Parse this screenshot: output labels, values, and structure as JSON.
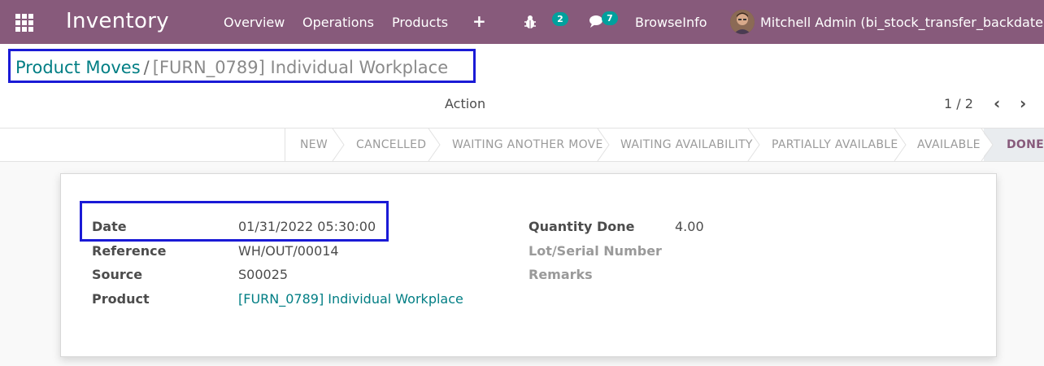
{
  "navbar": {
    "app_name": "Inventory",
    "menu": [
      "Overview",
      "Operations",
      "Products"
    ],
    "plus_icon": "+",
    "bug_badge": "2",
    "chat_badge": "7",
    "company": "BrowseInfo",
    "user": "Mitchell Admin (bi_stock_transfer_backdate)",
    "color": "#875a7b"
  },
  "breadcrumb": {
    "parent": "Product Moves",
    "separator": "/",
    "current": "[FURN_0789] Individual Workplace"
  },
  "control": {
    "action_label": "Action",
    "pager": "1 / 2"
  },
  "statusbar": {
    "steps": [
      "NEW",
      "CANCELLED",
      "WAITING ANOTHER MOVE",
      "WAITING AVAILABILITY",
      "PARTIALLY AVAILABLE",
      "AVAILABLE",
      "DONE"
    ],
    "active": "DONE"
  },
  "form": {
    "left": [
      {
        "label": "Date",
        "value": "01/31/2022 05:30:00"
      },
      {
        "label": "Reference",
        "value": "WH/OUT/00014"
      },
      {
        "label": "Source",
        "value": "S00025"
      },
      {
        "label": "Product",
        "value": "[FURN_0789] Individual Workplace"
      }
    ],
    "right": [
      {
        "label": "Quantity Done",
        "value": "4.00"
      },
      {
        "label": "Lot/Serial Number",
        "value": ""
      },
      {
        "label": "Remarks",
        "value": ""
      }
    ]
  },
  "colors": {
    "link": "#017e84",
    "highlight_box": "#1a1ad6",
    "badge": "#00a09d"
  }
}
